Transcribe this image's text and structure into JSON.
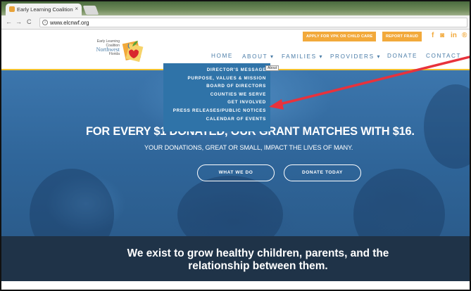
{
  "browser": {
    "tab_title": "Early Learning Coalition",
    "tab_close": "×",
    "url": "www.elcnwf.org",
    "back_glyph": "←",
    "forward_glyph": "→",
    "reload_glyph": "C",
    "info_glyph": "i"
  },
  "logo": {
    "line1": "Early Learning",
    "line2": "Coalition",
    "line3": "Northwest",
    "line4": "Florida"
  },
  "header": {
    "cta_vpk": "APPLY FOR VPK OR CHILD CARE",
    "cta_fraud": "REPORT FRAUD",
    "social": [
      "f",
      "◙",
      "in",
      "®"
    ],
    "nav": {
      "home": "HOME",
      "about": "ABOUT",
      "families": "FAMILIES",
      "providers": "PROVIDERS",
      "donate": "DONATE",
      "contact": "CONTACT"
    },
    "chevron": "▾",
    "tooltip": "About"
  },
  "dropdown": {
    "items": [
      "DIRECTOR'S MESSAGE",
      "PURPOSE, VALUES & MISSION",
      "BOARD OF DIRECTORS",
      "COUNTIES WE SERVE",
      "GET INVOLVED",
      "PRESS RELEASES/PUBLIC NOTICES",
      "CALENDAR OF EVENTS"
    ]
  },
  "hero": {
    "headline": "FOR EVERY $1 DONATED, OUR GRANT MATCHES WITH $16.",
    "subline": "YOUR DONATIONS, GREAT OR SMALL, IMPACT THE LIVES OF MANY.",
    "btn_what": "WHAT WE DO",
    "btn_donate": "DONATE TODAY"
  },
  "mission": {
    "line1": "We exist to grow healthy children, parents, and the",
    "line2": "relationship between them."
  },
  "colors": {
    "accent_orange": "#f2a93b",
    "brand_blue": "#4b7da8",
    "annotation_red": "#e8323c",
    "mission_bg": "#1f3348"
  }
}
